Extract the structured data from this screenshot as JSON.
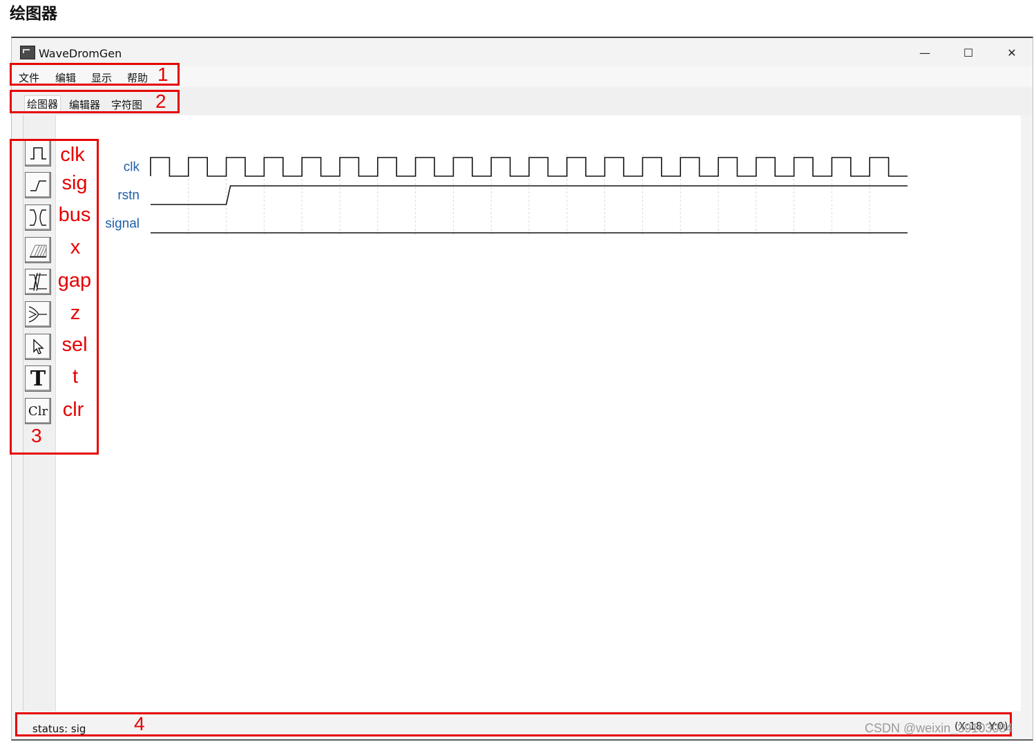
{
  "doc_heading": "绘图器",
  "window": {
    "title": "WaveDromGen",
    "minimize": "—",
    "maximize": "☐",
    "close": "✕"
  },
  "menu": [
    "文件",
    "编辑",
    "显示",
    "帮助"
  ],
  "tabs": [
    "绘图器",
    "编辑器",
    "字符图"
  ],
  "tools": [
    {
      "icon": "clock-wave-icon",
      "label": "clk"
    },
    {
      "icon": "signal-edge-icon",
      "label": "sig"
    },
    {
      "icon": "bus-cross-icon",
      "label": "bus"
    },
    {
      "icon": "hatch-x-icon",
      "label": "x"
    },
    {
      "icon": "gap-icon",
      "label": "gap"
    },
    {
      "icon": "high-z-icon",
      "label": "z"
    },
    {
      "icon": "cursor-select-icon",
      "label": "sel"
    },
    {
      "icon": "text-t-icon",
      "label": "t",
      "glyph": "T"
    },
    {
      "icon": "clear-icon",
      "label": "clr",
      "glyph": "Clr"
    }
  ],
  "waveform": {
    "signals": [
      {
        "name": "clk",
        "color": "#1f5faa",
        "wave": "pppppppppppppppppppp"
      },
      {
        "name": "rstn",
        "color": "#1f5faa",
        "wave": "0.1................."
      },
      {
        "name": "signal",
        "color": "#1f5faa",
        "wave": "0..................."
      }
    ],
    "cycles": 20,
    "grid": true
  },
  "annotations": {
    "color": "#e60000",
    "numbers": [
      "1",
      "2",
      "3",
      "4"
    ]
  },
  "status": {
    "text": "status: sig",
    "coord": "(X:18, Y:0)"
  },
  "watermark": "CSDN @weixin_39103084"
}
